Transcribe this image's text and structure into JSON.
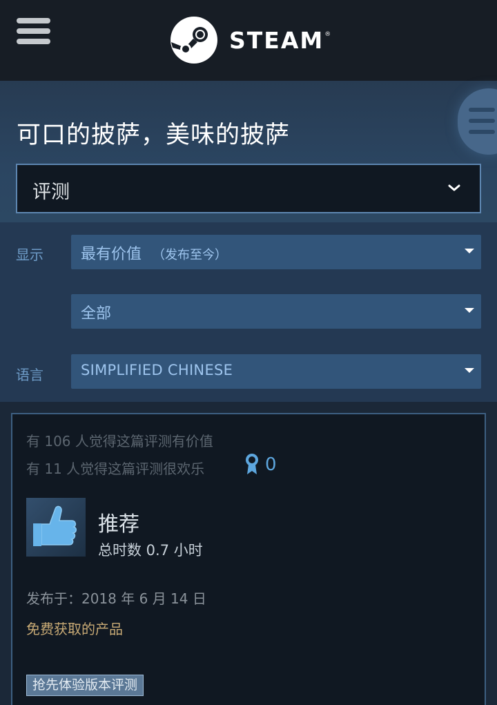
{
  "header": {
    "menu_icon": "hamburger-icon",
    "logo_icon": "steam-logo-icon",
    "brand": "STEAM",
    "registered_mark": "®"
  },
  "title_section": {
    "game_title": "可口的披萨，美味的披萨",
    "side_menu_icon": "hamburger-icon",
    "section_select": "评测",
    "section_select_icon": "chevron-down-icon"
  },
  "filters": {
    "show_label": "显示",
    "sort_value": "最有价值",
    "sort_sub": "（发布至今）",
    "type_value": "全部",
    "language_label": "语言",
    "language_value": "SIMPLIFIED CHINESE"
  },
  "review": {
    "helpful_line": "有 106 人觉得这篇评测有价值",
    "funny_line": "有 11 人觉得这篇评测很欢乐",
    "award_icon": "award-ribbon-icon",
    "award_count": "0",
    "thumb_icon": "thumbs-up-icon",
    "verdict": "推荐",
    "hours": "总时数 0.7 小时",
    "posted": "发布于：2018 年 6 月 14 日",
    "free_product": "免费获取的产品",
    "early_access_badge": "抢先体验版本评测"
  },
  "colors": {
    "header_bg": "#171d25",
    "page_bg": "#1b2838",
    "accent_blue": "#5da6de",
    "free_product_gold": "#c8aa75"
  }
}
